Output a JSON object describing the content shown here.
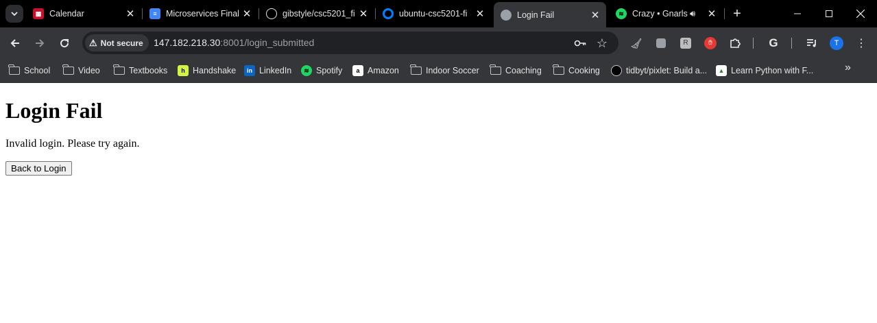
{
  "tabs": [
    {
      "title": "Calendar",
      "icon": "calendar-icon"
    },
    {
      "title": "Microservices Final",
      "icon": "docs-icon"
    },
    {
      "title": "gibstyle/csc5201_fi",
      "icon": "github-icon"
    },
    {
      "title": "ubuntu-csc5201-fi",
      "icon": "digitalocean-icon"
    },
    {
      "title": "Login Fail",
      "icon": "globe-icon",
      "active": true
    },
    {
      "title": "Crazy • Gnarls",
      "icon": "spotify-icon",
      "audio": true
    }
  ],
  "address_bar": {
    "security_label": "Not secure",
    "url_host": "147.182.218.30",
    "url_rest": ":8001/login_submitted"
  },
  "bookmarks": [
    {
      "label": "School",
      "icon": "folder-icon"
    },
    {
      "label": "Video",
      "icon": "folder-icon"
    },
    {
      "label": "Textbooks",
      "icon": "folder-icon"
    },
    {
      "label": "Handshake",
      "icon": "handshake-icon"
    },
    {
      "label": "LinkedIn",
      "icon": "linkedin-icon"
    },
    {
      "label": "Spotify",
      "icon": "spotify-icon"
    },
    {
      "label": "Amazon",
      "icon": "amazon-icon"
    },
    {
      "label": "Indoor Soccer",
      "icon": "folder-icon"
    },
    {
      "label": "Coaching",
      "icon": "folder-icon"
    },
    {
      "label": "Cooking",
      "icon": "folder-icon"
    },
    {
      "label": "tidbyt/pixlet: Build a...",
      "icon": "github-icon"
    },
    {
      "label": "Learn Python with F...",
      "icon": "python-course-icon"
    }
  ],
  "profile": {
    "initial": "T"
  },
  "page": {
    "heading": "Login Fail",
    "message": "Invalid login. Please try again.",
    "button_label": "Back to Login"
  },
  "colors": {
    "tab_strip": "#000000",
    "toolbar": "#35363a",
    "omnibox": "#202124",
    "avatar": "#1a73e8"
  }
}
